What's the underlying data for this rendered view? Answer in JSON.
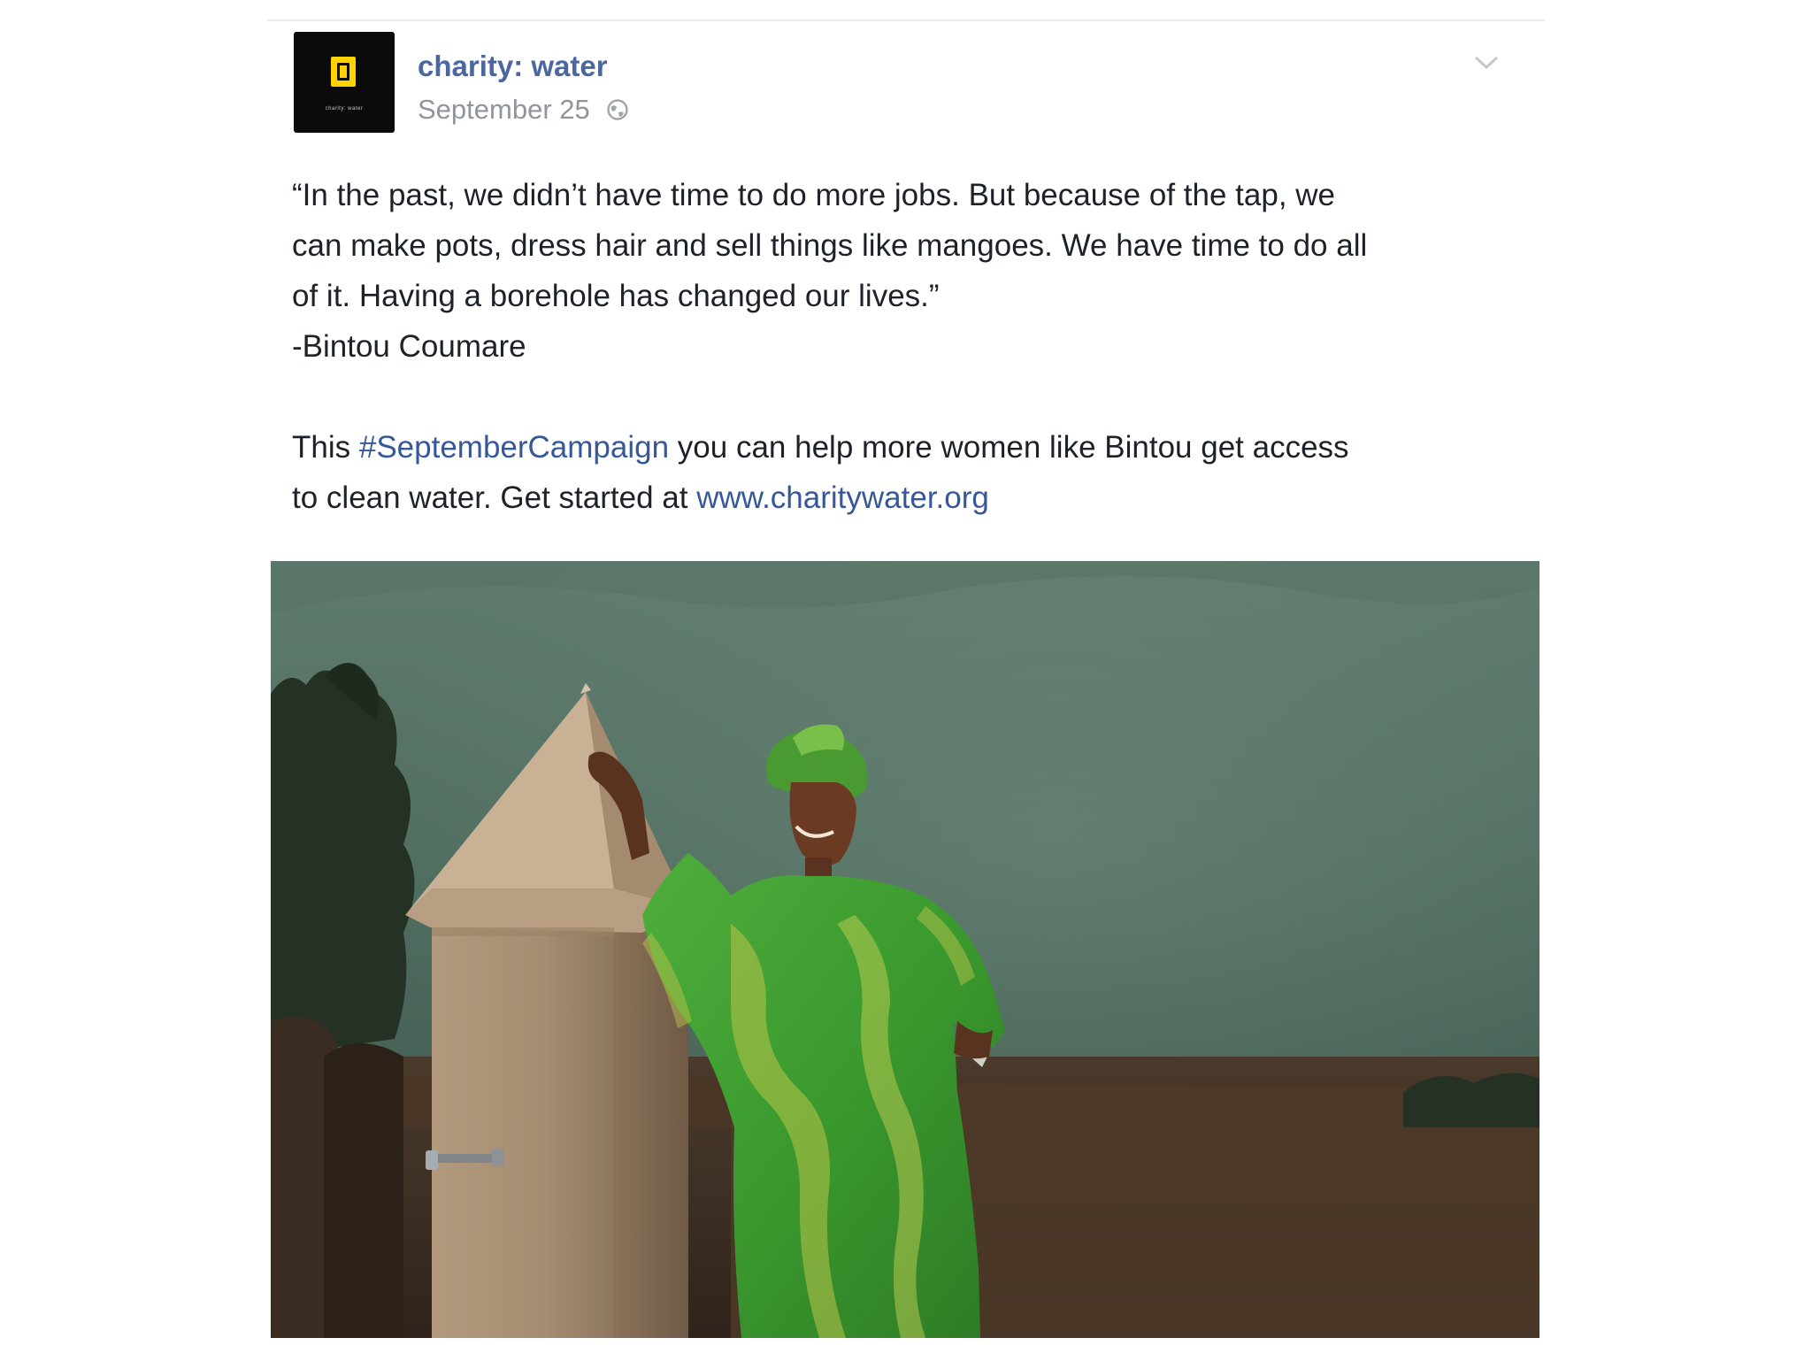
{
  "post": {
    "page_name": "charity: water",
    "date": "September 25",
    "avatar_wordmark": "charity: water",
    "quote": {
      "line1": "“In the past, we didn’t have time to do more jobs. But because of the tap, we",
      "line2": "can make pots, dress hair and sell things like mangoes. We have time to do all",
      "line3": "of it. Having a borehole has changed our lives.”",
      "attribution": "-Bintou Coumare"
    },
    "cta": {
      "prefix": "This ",
      "hashtag": "#SeptemberCampaign",
      "middle": " you can help more women like Bintou get access",
      "line2_prefix": "to clean water. Get started at ",
      "url": "www.charitywater.org"
    }
  },
  "icons": {
    "privacy": "globe-icon",
    "options": "chevron-down-icon"
  },
  "colors": {
    "link": "#365899",
    "page_name": "#4b67a1",
    "meta": "#90949c",
    "text": "#1d2129"
  }
}
